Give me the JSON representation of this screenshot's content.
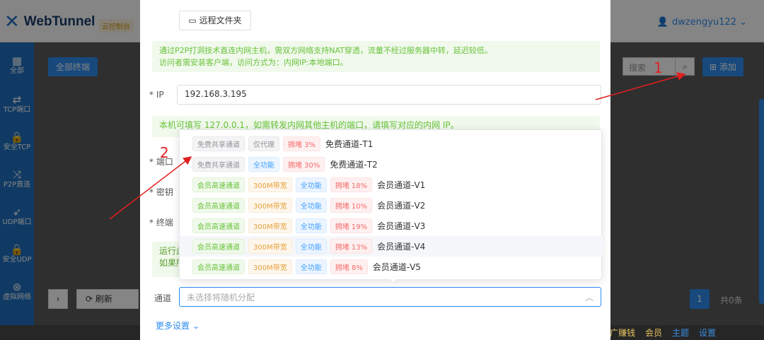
{
  "header": {
    "app_title": "WebTunnel",
    "cloud_badge": "云控制台",
    "user": "dwzengyu122 ⌄"
  },
  "sidebar": {
    "items": [
      {
        "label": "全部",
        "icon": "grid-icon"
      },
      {
        "label": "TCP端口",
        "icon": "swap-icon"
      },
      {
        "label": "安全TCP",
        "icon": "lock-icon"
      },
      {
        "label": "P2P直连",
        "icon": "shuffle-icon"
      },
      {
        "label": "UDP端口",
        "icon": "rocket-icon"
      },
      {
        "label": "安全UDP",
        "icon": "lock-icon"
      },
      {
        "label": "虚拟网络",
        "icon": "network-icon"
      }
    ]
  },
  "toolbar": {
    "all_terminals": "全部终端",
    "search_placeholder": "搜索",
    "add": "添加",
    "refresh": "刷新"
  },
  "pagination": {
    "page": "1",
    "total": "共0条"
  },
  "footer": {
    "items": [
      "广赚钱",
      "会员",
      "主题",
      "设置"
    ]
  },
  "dialog": {
    "remote_folder": "远程文件夹",
    "tip1_line1": "通过P2P打洞技术直连内网主机，需双方网络支持NAT穿透，流量不经过服务器中转，延迟较低。",
    "tip1_line2": "访问者需安装客户端，访问方式为：内网IP:本地端口。",
    "ip_label": "* IP",
    "ip_value": "192.168.3.195",
    "tip2": "本机可填写 127.0.0.1，如需转发内网其他主机的端口，请填写对应的内网 IP。",
    "port_label": "* 端口",
    "key_label": "* 密钥",
    "terminal_label": "* 终端",
    "run_tip1": "运行此",
    "run_tip2": "如果所",
    "channel_label": "通道",
    "channel_placeholder": "未选择将随机分配",
    "more_settings": "更多设置 ⌄"
  },
  "dropdown": {
    "options": [
      {
        "tags": [
          {
            "text": "免费共享通道",
            "style": "gray"
          },
          {
            "text": "仅代理",
            "style": "gray"
          },
          {
            "text": "拥堵 3%",
            "style": "red"
          }
        ],
        "name": "免费通道-T1"
      },
      {
        "tags": [
          {
            "text": "免费共享通道",
            "style": "gray"
          },
          {
            "text": "全功能",
            "style": "blue"
          },
          {
            "text": "拥堵 30%",
            "style": "red"
          }
        ],
        "name": "免费通道-T2"
      },
      {
        "tags": [
          {
            "text": "会员高速通道",
            "style": "green"
          },
          {
            "text": "300M带宽",
            "style": "orange"
          },
          {
            "text": "全功能",
            "style": "blue"
          },
          {
            "text": "拥堵 18%",
            "style": "red"
          }
        ],
        "name": "会员通道-V1"
      },
      {
        "tags": [
          {
            "text": "会员高速通道",
            "style": "green"
          },
          {
            "text": "300M带宽",
            "style": "orange"
          },
          {
            "text": "全功能",
            "style": "blue"
          },
          {
            "text": "拥堵 10%",
            "style": "red"
          }
        ],
        "name": "会员通道-V2"
      },
      {
        "tags": [
          {
            "text": "会员高速通道",
            "style": "green"
          },
          {
            "text": "300M带宽",
            "style": "orange"
          },
          {
            "text": "全功能",
            "style": "blue"
          },
          {
            "text": "拥堵 19%",
            "style": "red"
          }
        ],
        "name": "会员通道-V3"
      },
      {
        "tags": [
          {
            "text": "会员高速通道",
            "style": "green"
          },
          {
            "text": "300M带宽",
            "style": "orange"
          },
          {
            "text": "全功能",
            "style": "blue"
          },
          {
            "text": "拥堵 13%",
            "style": "red"
          }
        ],
        "name": "会员通道-V4"
      },
      {
        "tags": [
          {
            "text": "会员高速通道",
            "style": "green"
          },
          {
            "text": "300M带宽",
            "style": "orange"
          },
          {
            "text": "全功能",
            "style": "blue"
          },
          {
            "text": "拥堵 8%",
            "style": "red"
          }
        ],
        "name": "会员通道-V5"
      }
    ]
  },
  "annotations": {
    "one": "1",
    "two": "2",
    "color": "#e02020"
  }
}
